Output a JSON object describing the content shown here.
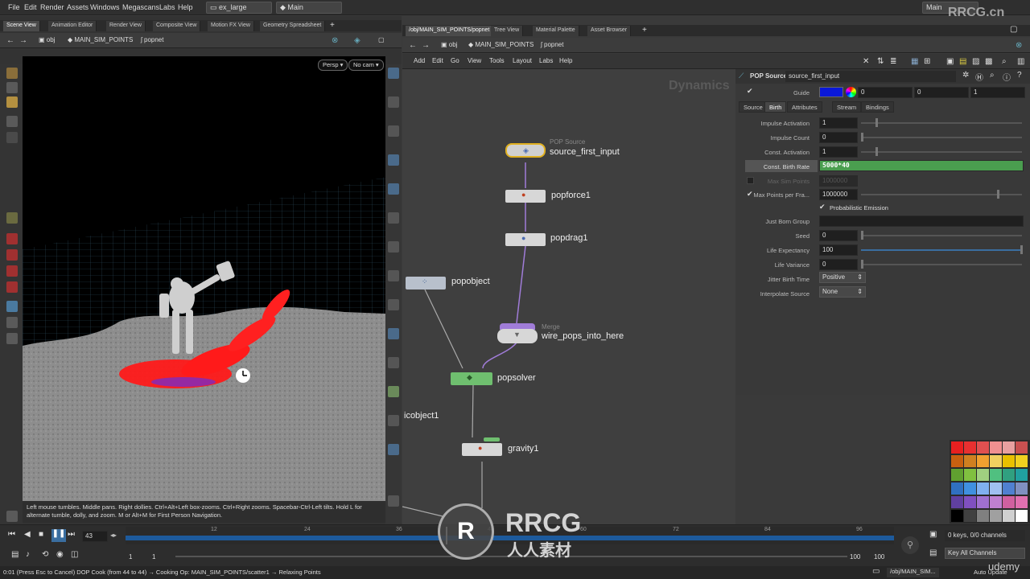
{
  "menubar": {
    "items": [
      "File",
      "Edit",
      "Render",
      "Assets",
      "Windows",
      "Megascans",
      "Labs",
      "Help"
    ],
    "desktop_dropdown": "ex_large",
    "context_dropdown": "Main",
    "right_dropdown": "Main"
  },
  "left_pane": {
    "tabs": [
      "Scene View",
      "Animation Editor",
      "Render View",
      "Composite View",
      "Motion FX View",
      "Geometry Spreadsheet"
    ],
    "path": {
      "root": "obj",
      "node": "MAIN_SIM_POINTS",
      "child": "popnet"
    },
    "viewport": {
      "camera_button": "Persp",
      "cam_dropdown": "No cam",
      "hint_text": "Left mouse tumbles. Middle pans. Right dollies. Ctrl+Alt+Left box-zooms. Ctrl+Right zooms. Spacebar-Ctrl-Left tilts. Hold L for alternate tumble, dolly, and zoom.    M or Alt+M for First Person Navigation."
    }
  },
  "right_pane": {
    "tabs": [
      "/obj/MAIN_SIM_POINTS/popnet",
      "Tree View",
      "Material Palette",
      "Asset Browser"
    ],
    "path": {
      "root": "obj",
      "node": "MAIN_SIM_POINTS",
      "child": "popnet"
    },
    "menu": [
      "Add",
      "Edit",
      "Go",
      "View",
      "Tools",
      "Layout",
      "Labs",
      "Help"
    ],
    "network": {
      "watermark": "Dynamics",
      "nodes": [
        {
          "name": "source_first_input",
          "type": "POP Source"
        },
        {
          "name": "popforce1",
          "type": ""
        },
        {
          "name": "popdrag1",
          "type": ""
        },
        {
          "name": "popobject",
          "type": ""
        },
        {
          "name": "wire_pops_into_here",
          "type": "Merge"
        },
        {
          "name": "popsolver",
          "type": ""
        },
        {
          "name": "icobject1",
          "type": ""
        },
        {
          "name": "gravity1",
          "type": ""
        }
      ]
    },
    "params": {
      "node_type": "POP Source",
      "node_name": "source_first_input",
      "guide_label": "Guide",
      "guide_values": [
        "0",
        "0",
        "1"
      ],
      "tabs": [
        "Source",
        "Birth",
        "Attributes",
        "Stream",
        "Bindings"
      ],
      "rows": [
        {
          "label": "Impulse Activation",
          "value": "1"
        },
        {
          "label": "Impulse Count",
          "value": "0"
        },
        {
          "label": "Const. Activation",
          "value": "1"
        },
        {
          "label": "Const. Birth Rate",
          "value": "5000*40"
        },
        {
          "label": "Max Sim Points",
          "value": "1000000"
        },
        {
          "label": "Max Points per Fra...",
          "value": "1000000"
        },
        {
          "label": "Probabilistic Emission",
          "value": ""
        },
        {
          "label": "Just Born Group",
          "value": ""
        },
        {
          "label": "Seed",
          "value": "0"
        },
        {
          "label": "Life Expectancy",
          "value": "100"
        },
        {
          "label": "Life Variance",
          "value": "0"
        },
        {
          "label": "Jitter Birth Time",
          "value": "Positive"
        },
        {
          "label": "Interpolate Source",
          "value": "None"
        }
      ]
    }
  },
  "timeline": {
    "current_frame": "43",
    "ticks": [
      "12",
      "24",
      "36",
      "48",
      "60",
      "72",
      "84",
      "96"
    ],
    "range_start": "1",
    "range_start2": "1",
    "range_end": "100",
    "range_end2": "100",
    "keys_label": "0 keys, 0/0 channels",
    "channels_dropdown": "Key All Channels"
  },
  "statusbar": {
    "message": "0:01 (Press Esc to Cancel) DOP Cook (from 44 to 44) → Cooking Op: MAIN_SIM_POINTS/scatter1 → Relaxing Points",
    "path_dropdown": "/obj/MAIN_SIM...",
    "update_mode": "Auto Update"
  },
  "watermarks": {
    "rrcg_top": "RRCG.cn",
    "rrcg_center": "RRCG",
    "rrcg_sub": "人人素材",
    "udemy": "udemy"
  },
  "colors": {
    "param_highlight": "#4a9e4f",
    "source_node_outline": "#e0b020",
    "merge_node": "#a07cd8",
    "solver_node": "#6fbf6f"
  },
  "palette": [
    "#e82020",
    "#e83030",
    "#e05050",
    "#f09090",
    "#e8a0a0",
    "#c85050",
    "#c86010",
    "#d08020",
    "#f0a030",
    "#f0d060",
    "#e8c000",
    "#f0d020",
    "#60a030",
    "#80c040",
    "#a0d080",
    "#50c080",
    "#30a080",
    "#20a0a0",
    "#3070c0",
    "#4090e0",
    "#80b0f0",
    "#a0c0f0",
    "#5080d0",
    "#8090c0",
    "#6040a0",
    "#8050c0",
    "#a070d0",
    "#c080d0",
    "#d060a0",
    "#e070b0",
    "#000000",
    "#404040",
    "#808080",
    "#a0a0a0",
    "#d0d0d0",
    "#ffffff"
  ]
}
